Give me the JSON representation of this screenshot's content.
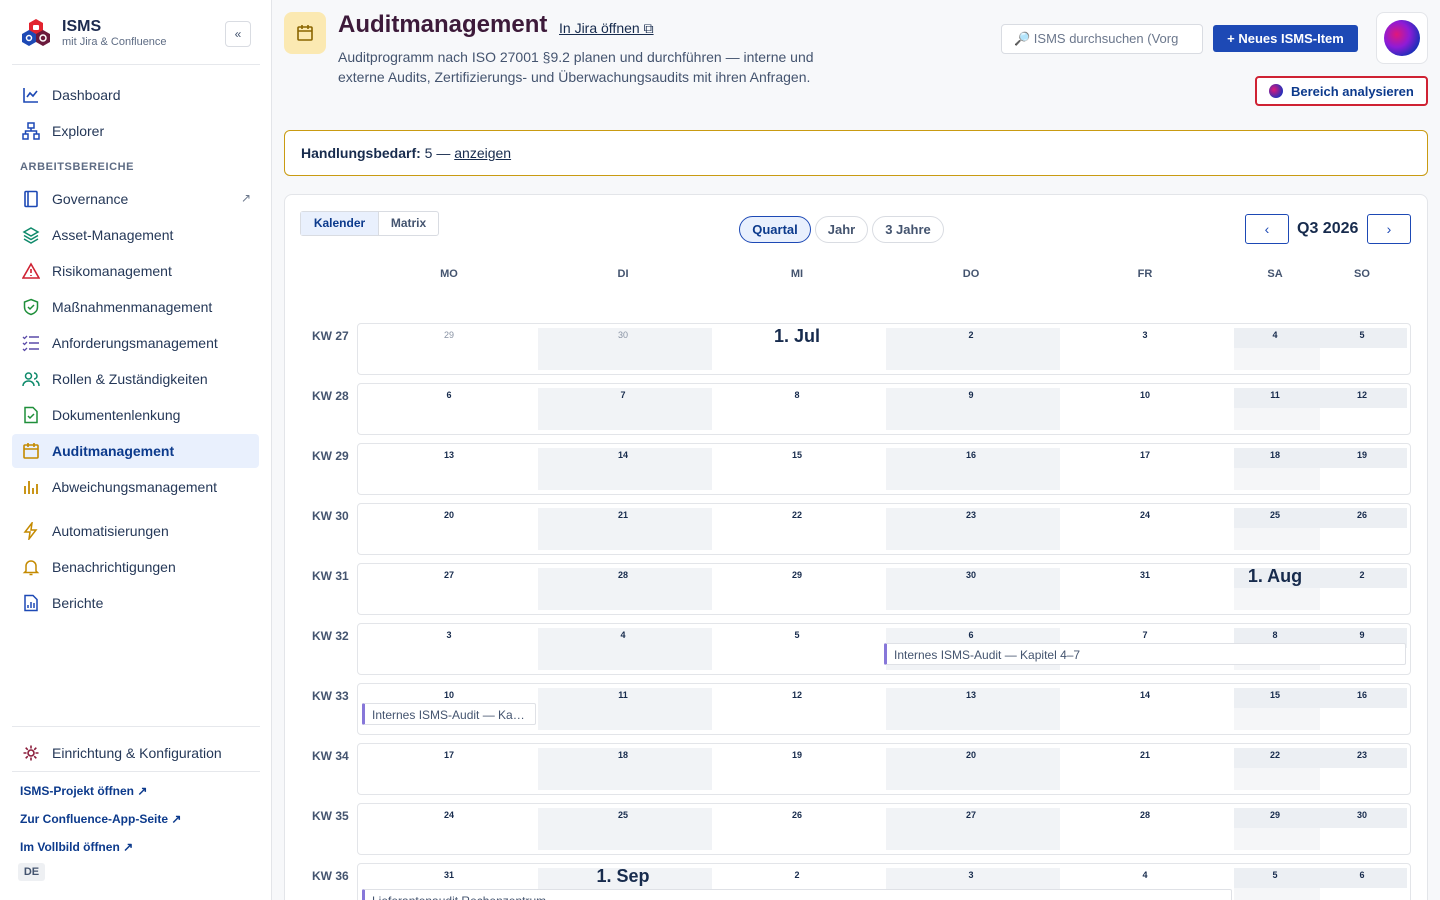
{
  "sidebar": {
    "brand_name": "ISMS",
    "brand_sub": "mit Jira & Confluence",
    "collapse": "«",
    "section": "ARBEITSBEREICHE",
    "items": [
      {
        "label": "Dashboard"
      },
      {
        "label": "Explorer"
      },
      {
        "label": "Governance",
        "ext": "↗"
      },
      {
        "label": "Asset-Management"
      },
      {
        "label": "Risikomanagement"
      },
      {
        "label": "Maßnahmenmanagement"
      },
      {
        "label": "Anforderungsmanagement"
      },
      {
        "label": "Rollen & Zuständigkeiten"
      },
      {
        "label": "Dokumentenlenkung"
      },
      {
        "label": "Auditmanagement"
      },
      {
        "label": "Abweichungsmanagement"
      },
      {
        "label": "Automatisierungen"
      },
      {
        "label": "Benachrichtigungen"
      },
      {
        "label": "Berichte"
      },
      {
        "label": "Einrichtung & Konfiguration"
      }
    ],
    "links": [
      "ISMS-Projekt öffnen ↗",
      "Zur Confluence-App-Seite ↗",
      "Im Vollbild öffnen ↗"
    ],
    "lang": "DE"
  },
  "header": {
    "title": "Auditmanagement",
    "jira_link": "In Jira öffnen ⧉",
    "description": "Auditprogramm nach ISO 27001 §9.2 planen und durchführen — interne und externe Audits, Zertifizierungs- und Überwachungsaudits mit ihren Anfragen.",
    "search_placeholder": "🔎 ISMS durchsuchen (Vorg",
    "new_button": "+ Neues ISMS-Item",
    "analyze_button": "Bereich analysieren"
  },
  "alert": {
    "label": "Handlungsbedarf:",
    "text": " 5 — ",
    "link": "anzeigen"
  },
  "calendar": {
    "views": [
      "Kalender",
      "Matrix"
    ],
    "ranges": [
      "Quartal",
      "Jahr",
      "3 Jahre"
    ],
    "prev": "‹",
    "next": "›",
    "period": "Q3 2026",
    "weekdays": [
      "MO",
      "DI",
      "MI",
      "DO",
      "FR",
      "SA",
      "SO"
    ],
    "weeks": [
      {
        "label": "KW 27",
        "days": [
          "29",
          "30",
          "1. Jul",
          "2",
          "3",
          "4",
          "5"
        ]
      },
      {
        "label": "KW 28",
        "days": [
          "6",
          "7",
          "8",
          "9",
          "10",
          "11",
          "12"
        ]
      },
      {
        "label": "KW 29",
        "days": [
          "13",
          "14",
          "15",
          "16",
          "17",
          "18",
          "19"
        ]
      },
      {
        "label": "KW 30",
        "days": [
          "20",
          "21",
          "22",
          "23",
          "24",
          "25",
          "26"
        ]
      },
      {
        "label": "KW 31",
        "days": [
          "27",
          "28",
          "29",
          "30",
          "31",
          "1. Aug",
          "2"
        ]
      },
      {
        "label": "KW 32",
        "days": [
          "3",
          "4",
          "5",
          "6",
          "7",
          "8",
          "9"
        ]
      },
      {
        "label": "KW 33",
        "days": [
          "10",
          "11",
          "12",
          "13",
          "14",
          "15",
          "16"
        ]
      },
      {
        "label": "KW 34",
        "days": [
          "17",
          "18",
          "19",
          "20",
          "21",
          "22",
          "23"
        ]
      },
      {
        "label": "KW 35",
        "days": [
          "24",
          "25",
          "26",
          "27",
          "28",
          "29",
          "30"
        ]
      },
      {
        "label": "KW 36",
        "days": [
          "31",
          "1. Sep",
          "2",
          "3",
          "4",
          "5",
          "6"
        ]
      }
    ],
    "events": [
      {
        "title": "Internes ISMS-Audit — Kapitel 4–7"
      },
      {
        "title": "Internes ISMS-Audit — Ka…"
      },
      {
        "title": "Lieferantenaudit Rechenzentrum"
      }
    ]
  }
}
